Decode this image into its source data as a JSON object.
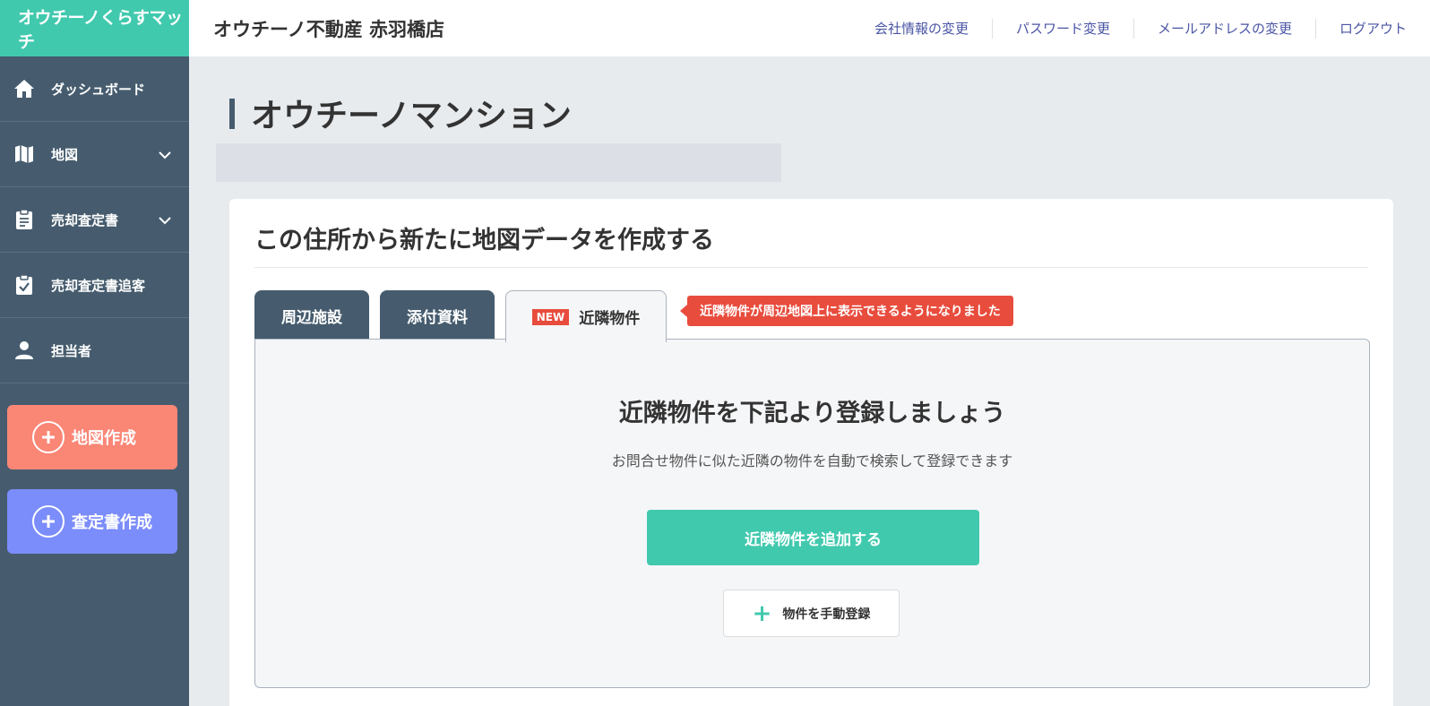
{
  "app": {
    "logo_text": "オウチーノくらすマッチ"
  },
  "header": {
    "store_name": "オウチーノ不動産 赤羽橋店",
    "links": [
      "会社情報の変更",
      "パスワード変更",
      "メールアドレスの変更",
      "ログアウト"
    ]
  },
  "sidebar": {
    "items": [
      {
        "label": "ダッシュボード",
        "icon": "home-icon"
      },
      {
        "label": "地図",
        "icon": "map-icon",
        "expandable": true
      },
      {
        "label": "売却査定書",
        "icon": "clipboard-icon",
        "expandable": true
      },
      {
        "label": "売却査定書追客",
        "icon": "clipboard-check-icon"
      },
      {
        "label": "担当者",
        "icon": "person-icon"
      }
    ],
    "create_map_label": "地図作成",
    "create_report_label": "査定書作成"
  },
  "page": {
    "title": "オウチーノマンション"
  },
  "card": {
    "title": "この住所から新たに地図データを作成する",
    "tabs": [
      "周辺施設",
      "添付資料",
      "近隣物件"
    ],
    "new_badge": "NEW",
    "notice": "近隣物件が周辺地図上に表示できるようになりました",
    "panel": {
      "heading": "近隣物件を下記より登録しましょう",
      "description": "お問合せ物件に似た近隣の物件を自動で検索して登録できます",
      "add_button": "近隣物件を追加する",
      "manual_button": "物件を手動登録"
    }
  },
  "colors": {
    "sidebar": "#465c6e",
    "accent_teal": "#41c9ae",
    "coral": "#fa8676",
    "indigo": "#7b8cfb",
    "notice_red": "#e84c3d"
  }
}
